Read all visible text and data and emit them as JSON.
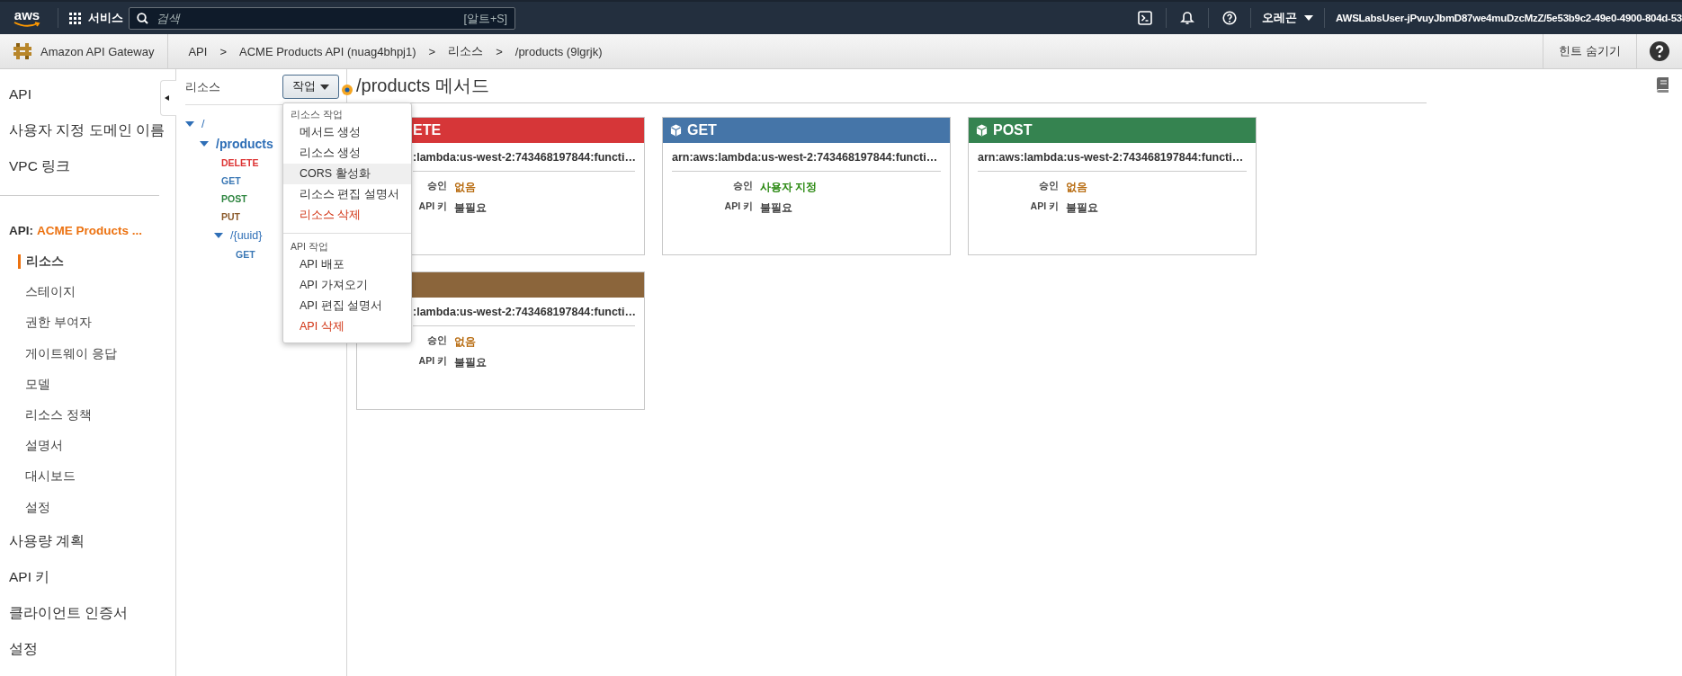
{
  "top_nav": {
    "logo": "aws",
    "services": "서비스",
    "search": {
      "placeholder": "검색",
      "shortcut": "[알트+S]"
    },
    "region": "오레곤",
    "account": "AWSLabsUser-jPvuyJbmD87we4muDzcMzZ/5e53b9c2-49e0-4900-804d-53"
  },
  "breadcrumb_bar": {
    "service": "Amazon API Gateway",
    "crumbs": [
      {
        "kind": "link",
        "text": "API"
      },
      {
        "kind": "separator",
        "text": ">"
      },
      {
        "kind": "link",
        "text": "ACME Products API (nuag4bhpj1)"
      },
      {
        "kind": "separator",
        "text": ">"
      },
      {
        "kind": "link",
        "text": "리소스"
      },
      {
        "kind": "separator",
        "text": ">"
      },
      {
        "kind": "current",
        "text": "/products (9lgrjk)"
      }
    ],
    "hint_toggle": "힌트 숨기기"
  },
  "sidebar": {
    "top_items": [
      {
        "label": "API",
        "selected": false
      },
      {
        "label": "사용자 지정 도메인 이름",
        "selected": false
      },
      {
        "label": "VPC 링크",
        "selected": false
      }
    ],
    "api_section": {
      "prefix": "API:",
      "name": "ACME Products ..."
    },
    "api_items": [
      {
        "label": "리소스",
        "selected": true
      },
      {
        "label": "스테이지",
        "selected": false
      },
      {
        "label": "권한 부여자",
        "selected": false
      },
      {
        "label": "게이트웨이 응답",
        "selected": false
      },
      {
        "label": "모델",
        "selected": false
      },
      {
        "label": "리소스 정책",
        "selected": false
      },
      {
        "label": "설명서",
        "selected": false
      },
      {
        "label": "대시보드",
        "selected": false
      },
      {
        "label": "설정",
        "selected": false
      }
    ],
    "bottom_items": [
      {
        "label": "사용량 계획",
        "selected": false
      },
      {
        "label": "API 키",
        "selected": false
      },
      {
        "label": "클라이언트 인증서",
        "selected": false
      },
      {
        "label": "설정",
        "selected": false
      }
    ]
  },
  "resources_panel": {
    "title": "리소스",
    "actions_button": "작업",
    "tree": [
      {
        "label": "/",
        "expanded": true,
        "selected": false,
        "children": [
          {
            "label": "/products",
            "expanded": true,
            "selected": true,
            "methods": [
              {
                "label": "DELETE",
                "color": "#dd3333"
              },
              {
                "label": "GET",
                "color": "#3b78b5"
              },
              {
                "label": "POST",
                "color": "#2e8540"
              },
              {
                "label": "PUT",
                "color": "#8b5a2b"
              }
            ],
            "children": [
              {
                "label": "/{uuid}",
                "expanded": true,
                "selected": false,
                "methods": [
                  {
                    "label": "GET",
                    "color": "#3b78b5"
                  }
                ]
              }
            ]
          }
        ]
      }
    ]
  },
  "actions_menu": {
    "sections": [
      {
        "title": "리소스 작업",
        "items": [
          {
            "label": "메서드 생성",
            "kind": "normal",
            "selected": false
          },
          {
            "label": "리소스 생성",
            "kind": "normal",
            "selected": false
          },
          {
            "label": "CORS 활성화",
            "kind": "normal",
            "selected": true
          },
          {
            "label": "리소스 편집 설명서",
            "kind": "normal",
            "selected": false
          },
          {
            "label": "리소스 삭제",
            "kind": "danger",
            "selected": false
          }
        ]
      },
      {
        "title": "API 작업",
        "items": [
          {
            "label": "API 배포",
            "kind": "normal",
            "selected": false
          },
          {
            "label": "API 가져오기",
            "kind": "normal",
            "selected": false
          },
          {
            "label": "API 편집 설명서",
            "kind": "normal",
            "selected": false
          },
          {
            "label": "API 삭제",
            "kind": "danger",
            "selected": false
          }
        ]
      }
    ]
  },
  "content": {
    "title": "/products 메서드",
    "method_cards": [
      {
        "method": "ETE",
        "color": "#d63638",
        "covered": true,
        "arn": ":lambda:us-west-2:743468197844:functi…",
        "rows": [
          {
            "label": "승인",
            "value": "없음",
            "color": "#b36200"
          },
          {
            "label": "API 키",
            "value": "불필요",
            "color": "#333333"
          }
        ]
      },
      {
        "method": "GET",
        "color": "#4575a8",
        "covered": false,
        "arn": "arn:aws:lambda:us-west-2:743468197844:functi…",
        "rows": [
          {
            "label": "승인",
            "value": "사용자 지정",
            "color": "#1d8102"
          },
          {
            "label": "API 키",
            "value": "불필요",
            "color": "#333333"
          }
        ]
      },
      {
        "method": "POST",
        "color": "#358350",
        "covered": false,
        "arn": "arn:aws:lambda:us-west-2:743468197844:functi…",
        "rows": [
          {
            "label": "승인",
            "value": "없음",
            "color": "#b36200"
          },
          {
            "label": "API 키",
            "value": "불필요",
            "color": "#333333"
          }
        ]
      },
      {
        "color": "#8b653b",
        "covered": true,
        "arn": ":lambda:us-west-2:743468197844:functi…",
        "rows": [
          {
            "label": "승인",
            "value": "없음",
            "color": "#b36200"
          },
          {
            "label": "API 키",
            "value": "불필요",
            "color": "#333333"
          }
        ]
      }
    ]
  }
}
